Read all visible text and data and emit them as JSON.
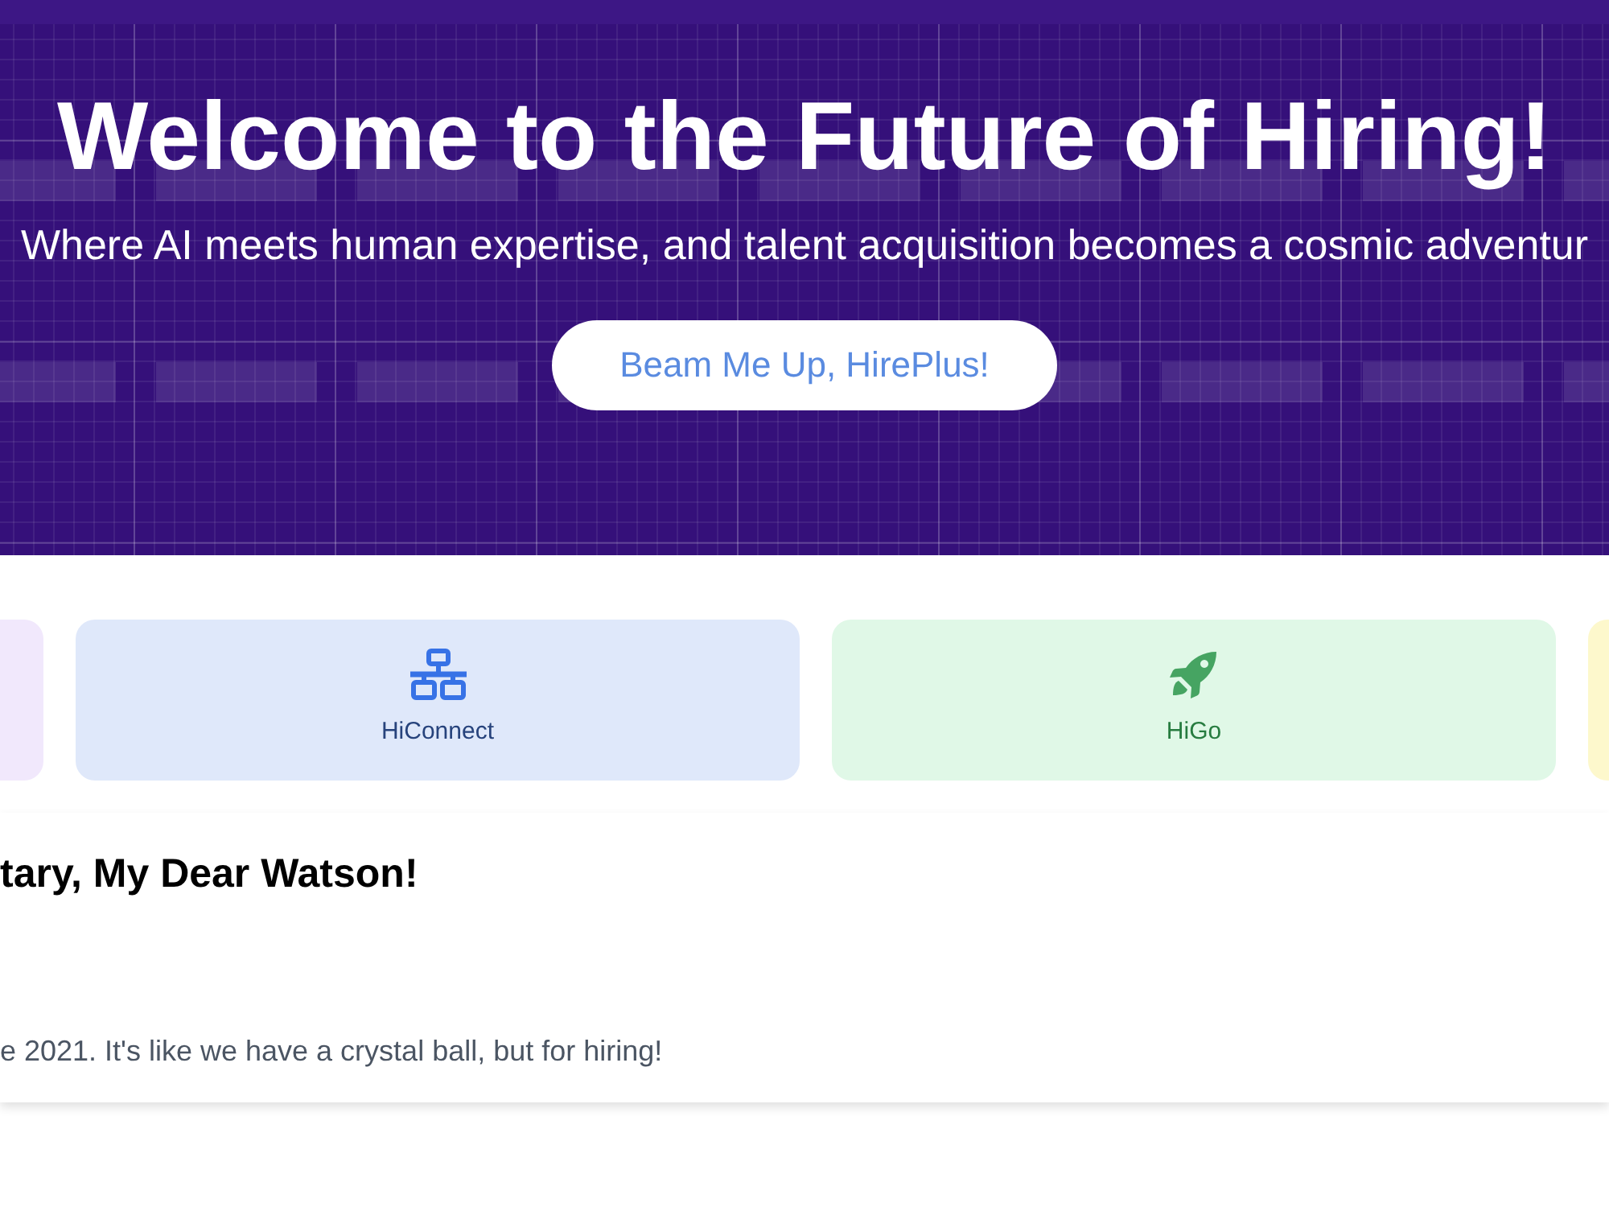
{
  "hero": {
    "title": "Welcome to the Future of Hiring!",
    "subtitle": "Where AI meets human expertise, and talent acquisition becomes a cosmic adventur",
    "button": "Beam Me Up, HirePlus!"
  },
  "products": [
    {
      "color": "#f1e8fc"
    },
    {
      "label": "HiConnect",
      "color": "#dfe8fa"
    },
    {
      "label": "HiGo",
      "color": "#e0f8e7"
    },
    {
      "color": "#fdf8cc"
    }
  ],
  "section": {
    "heading": "tary, My Dear Watson!",
    "text": "e 2021. It's like we have a crystal ball, but for hiring!"
  }
}
